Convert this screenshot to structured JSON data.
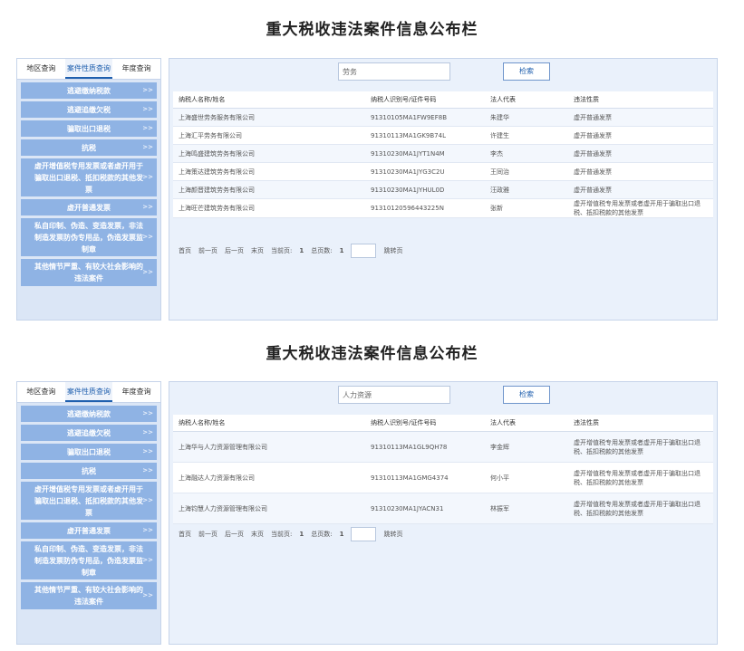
{
  "title": "重大税收违法案件信息公布栏",
  "tabs": [
    "地区查询",
    "案件性质查询",
    "年度查询"
  ],
  "side_items": [
    {
      "label": "逃避缴纳税款",
      "lines": 1
    },
    {
      "label": "逃避追缴欠税",
      "lines": 1
    },
    {
      "label": "骗取出口退税",
      "lines": 1
    },
    {
      "label": "抗税",
      "lines": 1
    },
    {
      "label": "虚开增值税专用发票或者虚开用于骗取出口退税、抵扣税款的其他发票",
      "lines": 3
    },
    {
      "label": "虚开普通发票",
      "lines": 1
    },
    {
      "label": "私自印制、伪造、变造发票，非法制造发票防伪专用品，伪造发票监制章",
      "lines": 3
    },
    {
      "label": "其他情节严重、有较大社会影响的违法案件",
      "lines": 2
    }
  ],
  "chevron": ">>",
  "table_headers": [
    "纳税人名称/姓名",
    "纳税人识别号/证件号码",
    "法人代表",
    "违法性质"
  ],
  "search_button": "检索",
  "panel_a": {
    "search_value": "劳务",
    "rows": [
      [
        "上海盛世劳务服务有限公司",
        "91310105MA1FW9EF8B",
        "朱建华",
        "虚开普通发票"
      ],
      [
        "上海汇平劳务有限公司",
        "91310113MA1GK9B74L",
        "许建生",
        "虚开普通发票"
      ],
      [
        "上海鸣盛建筑劳务有限公司",
        "91310230MA1JYT1N4M",
        "李杰",
        "虚开普通发票"
      ],
      [
        "上海策达建筑劳务有限公司",
        "91310230MA1JYG3C2U",
        "王同治",
        "虚开普通发票"
      ],
      [
        "上海颜晋建筑劳务有限公司",
        "91310230MA1JYHUL0D",
        "汪政雅",
        "虚开普通发票"
      ],
      [
        "上海旺芒建筑劳务有限公司",
        "91310120596443225N",
        "张新",
        "虚开增值税专用发票或者虚开用于骗取出口退税、抵扣税款的其他发票"
      ]
    ],
    "pager": {
      "first": "首页",
      "prev": "前一页",
      "next": "后一页",
      "last": "末页",
      "current_label": "当前页:",
      "current": "1",
      "total_label": "总页数:",
      "total": "1",
      "goto": "跳转页"
    }
  },
  "panel_b": {
    "search_value": "人力资源",
    "rows": [
      [
        "上海华与人力资源管理有限公司",
        "91310113MA1GL9QH78",
        "李金辉",
        "虚开增值税专用发票或者虚开用于骗取出口退税、抵扣税款的其他发票"
      ],
      [
        "上海融达人力资源有限公司",
        "91310113MA1GMG4374",
        "何小平",
        "虚开增值税专用发票或者虚开用于骗取出口退税、抵扣税款的其他发票"
      ],
      [
        "上海钧慧人力资源管理有限公司",
        "91310230MA1JYACN31",
        "林振军",
        "虚开增值税专用发票或者虚开用于骗取出口退税、抵扣税款的其他发票"
      ]
    ],
    "pager": {
      "first": "首页",
      "prev": "前一页",
      "next": "后一页",
      "last": "末页",
      "current_label": "当前页:",
      "current": "1",
      "total_label": "总页数:",
      "total": "1",
      "goto": "跳转页"
    }
  }
}
